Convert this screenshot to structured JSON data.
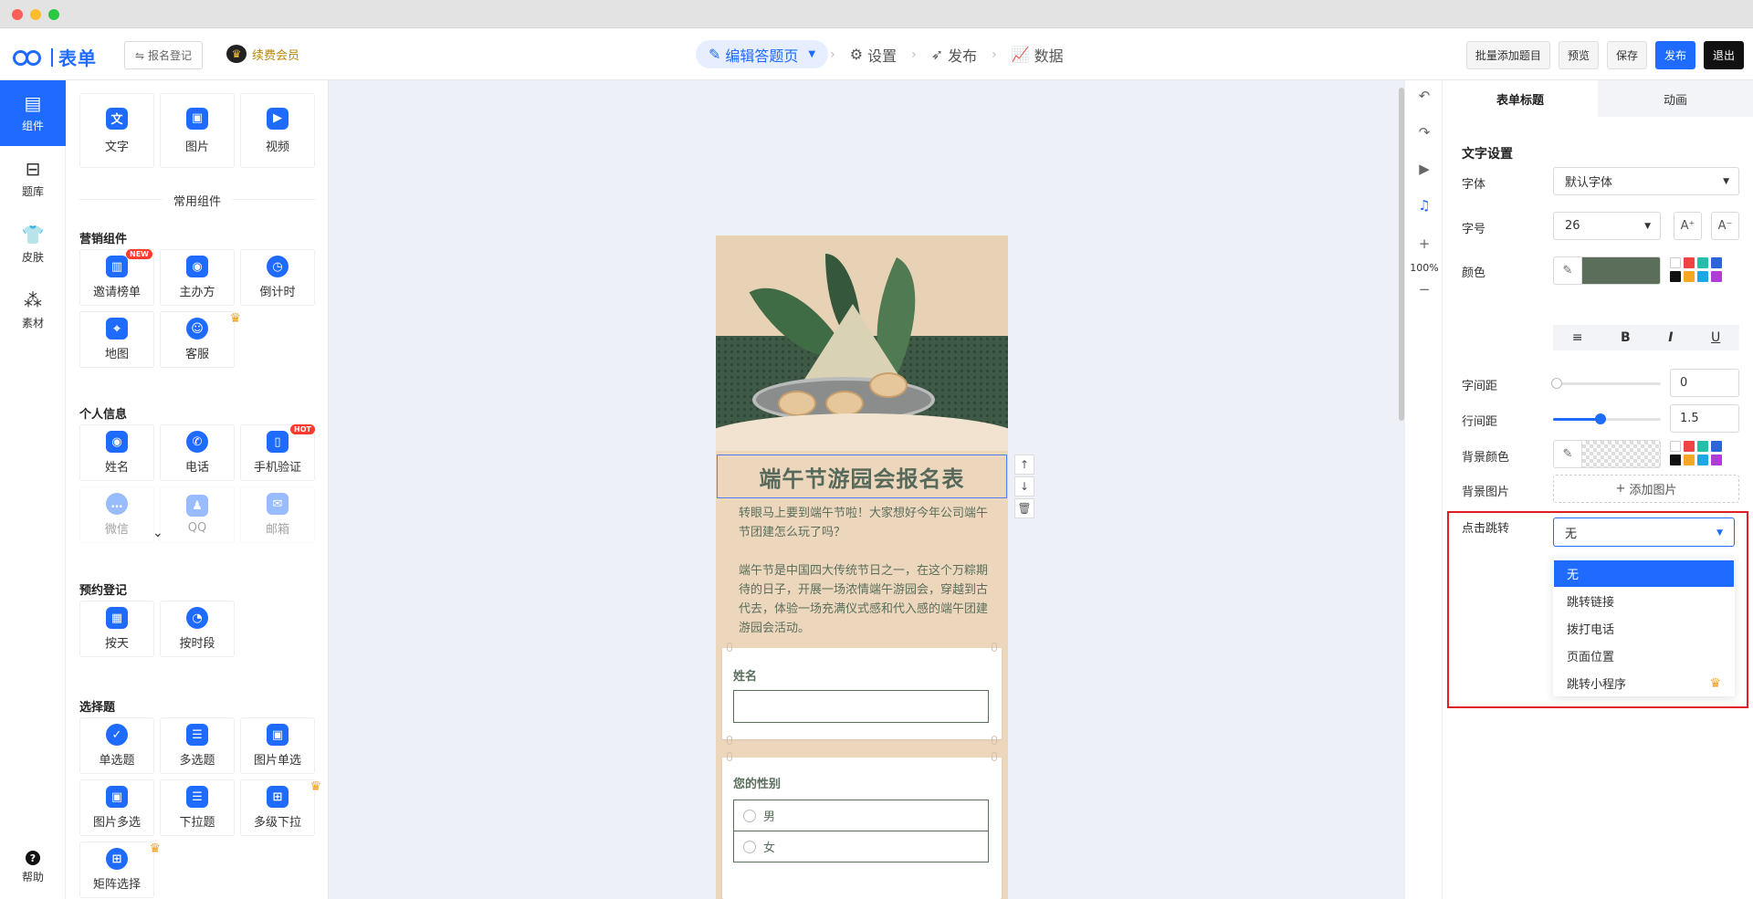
{
  "topbar": {
    "logo_text": "表单",
    "form_name_btn": "报名登记",
    "vip_label": "续费会员",
    "steps": [
      {
        "label": "编辑答题页",
        "icon": "edit-icon"
      },
      {
        "label": "设置",
        "icon": "gear-icon"
      },
      {
        "label": "发布",
        "icon": "send-icon"
      },
      {
        "label": "数据",
        "icon": "chart-icon"
      }
    ],
    "actions": {
      "batch_add": "批量添加题目",
      "preview": "预览",
      "save": "保存",
      "publish": "发布",
      "exit": "退出"
    }
  },
  "leftnav": {
    "items": [
      {
        "label": "组件",
        "icon": "component-icon"
      },
      {
        "label": "题库",
        "icon": "question-bank-icon"
      },
      {
        "label": "皮肤",
        "icon": "shirt-icon"
      },
      {
        "label": "素材",
        "icon": "material-icon"
      }
    ],
    "help": "帮助"
  },
  "components": {
    "basic": [
      "文字",
      "图片",
      "视频"
    ],
    "common_title": "常用组件",
    "marketing_title": "营销组件",
    "marketing": [
      "邀请榜单",
      "主办方",
      "倒计时",
      "地图",
      "客服"
    ],
    "marketing_badge": "NEW",
    "personal_title": "个人信息",
    "personal": [
      "姓名",
      "电话",
      "手机验证",
      "微信",
      "QQ",
      "邮箱"
    ],
    "personal_badge": "HOT",
    "booking_title": "预约登记",
    "booking": [
      "按天",
      "按时段"
    ],
    "choice_title": "选择题",
    "choice": [
      "单选题",
      "多选题",
      "图片单选",
      "图片多选",
      "下拉题",
      "多级下拉",
      "矩阵选择"
    ]
  },
  "canvas": {
    "form_title": "端午节游园会报名表",
    "desc_1": "转眼马上要到端午节啦！大家想好今年公司端午节团建怎么玩了吗？",
    "desc_2": "端午节是中国四大传统节日之一，在这个万粽期待的日子，开展一场浓情端午游园会，穿越到古代去，体验一场充满仪式感和代入感的端午团建游园会活动。",
    "q1_label": "姓名",
    "q2_label": "您的性别",
    "q2_options": [
      "男",
      "女"
    ]
  },
  "toolstrip": {
    "zoom": "100%"
  },
  "props": {
    "tabs": [
      "表单标题",
      "动画"
    ],
    "section": "文字设置",
    "font_label": "字体",
    "font_value": "默认字体",
    "size_label": "字号",
    "size_value": "26",
    "size_up": "A⁺",
    "size_down": "A⁻",
    "color_label": "颜色",
    "color_value": "#5a6e5a",
    "palette": [
      "#ffffff",
      "#f04444",
      "#22c0a8",
      "#2a66d6",
      "#111111",
      "#f5a623",
      "#1aa9e6",
      "#b03cd6"
    ],
    "letter_spacing_label": "字间距",
    "letter_spacing_value": "0",
    "line_height_label": "行间距",
    "line_height_value": "1.5",
    "bg_color_label": "背景颜色",
    "bg_image_label": "背景图片",
    "add_image": "添加图片",
    "jump_label": "点击跳转",
    "jump_value": "无",
    "jump_options": [
      "无",
      "跳转链接",
      "拨打电话",
      "页面位置",
      "跳转小程序"
    ]
  }
}
